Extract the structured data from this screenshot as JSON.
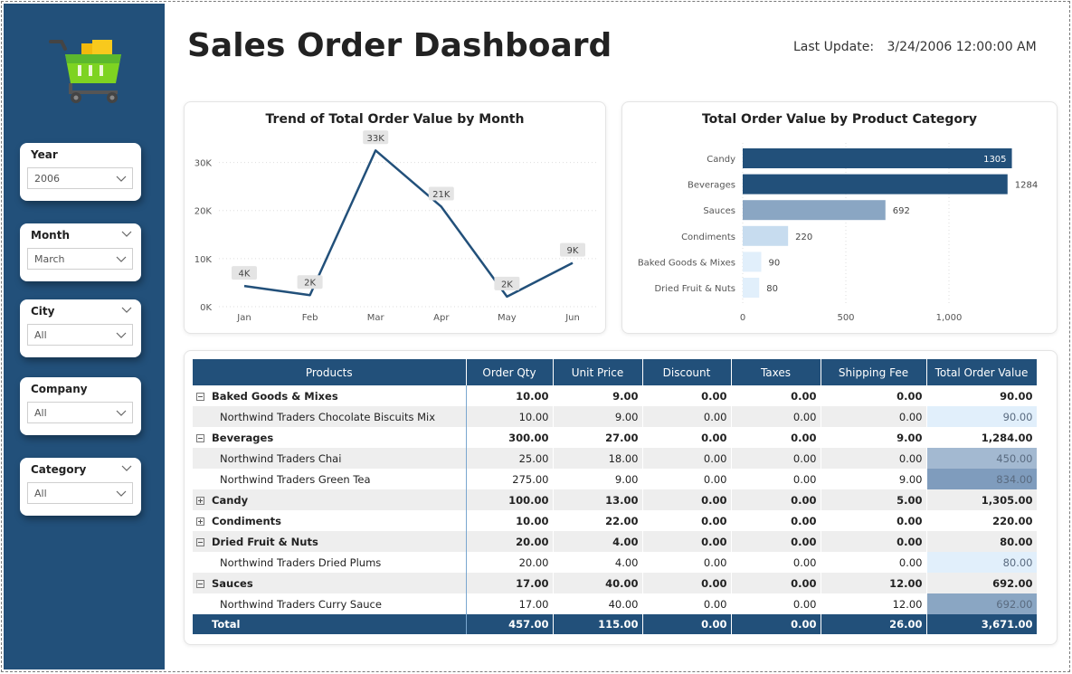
{
  "header": {
    "title": "Sales Order Dashboard",
    "last_update_label": "Last Update:",
    "last_update_value": "3/24/2006 12:00:00 AM"
  },
  "sidebar": {
    "logo_icon": "shopping-cart-icon",
    "slicers": [
      {
        "title": "Year",
        "value": "2006",
        "has_top_chevron": false
      },
      {
        "title": "Month",
        "value": "March",
        "has_top_chevron": true
      },
      {
        "title": "City",
        "value": "All",
        "has_top_chevron": true
      },
      {
        "title": "Company",
        "value": "All",
        "has_top_chevron": false
      },
      {
        "title": "Category",
        "value": "All",
        "has_top_chevron": true
      }
    ]
  },
  "colors": {
    "sidebar": "#22507a",
    "bar_dark": "#22507a",
    "bar_mid": "#8aa6c3",
    "bar_light": "#c7dcef",
    "bar_lightest": "#e1effb",
    "line": "#22507a"
  },
  "chart_data": [
    {
      "type": "line",
      "title": "Trend of Total Order Value by Month",
      "categories": [
        "Jan",
        "Feb",
        "Mar",
        "Apr",
        "May",
        "Jun"
      ],
      "values": [
        4300,
        2400,
        32500,
        20800,
        2100,
        9100
      ],
      "data_labels": [
        "4K",
        "2K",
        "33K",
        "21K",
        "2K",
        "9K"
      ],
      "y_ticks": [
        "0K",
        "10K",
        "20K",
        "30K"
      ],
      "ylim": [
        0,
        35000
      ],
      "grid": true
    },
    {
      "type": "bar",
      "orientation": "horizontal",
      "title": "Total Order Value by Product Category",
      "categories": [
        "Candy",
        "Beverages",
        "Sauces",
        "Condiments",
        "Baked Goods & Mixes",
        "Dried Fruit & Nuts"
      ],
      "values": [
        1305,
        1284,
        692,
        220,
        90,
        80
      ],
      "data_labels": [
        "1305",
        "1284",
        "692",
        "220",
        "90",
        "80"
      ],
      "x_ticks": [
        "0",
        "500",
        "1,000"
      ],
      "xlim": [
        0,
        1500
      ],
      "grid": true
    }
  ],
  "table": {
    "columns": [
      "Products",
      "Order Qty",
      "Unit Price",
      "Discount",
      "Taxes",
      "Shipping Fee",
      "Total Order Value"
    ],
    "rows": [
      {
        "kind": "group",
        "expander": "minus",
        "cells": [
          "Baked Goods & Mixes",
          "10.00",
          "9.00",
          "0.00",
          "0.00",
          "0.00",
          "90.00"
        ],
        "stripe": false,
        "shade": null
      },
      {
        "kind": "detail",
        "cells": [
          "Northwind Traders Chocolate Biscuits Mix",
          "10.00",
          "9.00",
          "0.00",
          "0.00",
          "0.00",
          "90.00"
        ],
        "stripe": true,
        "shade": "#e1effb"
      },
      {
        "kind": "group",
        "expander": "minus",
        "cells": [
          "Beverages",
          "300.00",
          "27.00",
          "0.00",
          "0.00",
          "9.00",
          "1,284.00"
        ],
        "stripe": false,
        "shade": null
      },
      {
        "kind": "detail",
        "cells": [
          "Northwind Traders Chai",
          "25.00",
          "18.00",
          "0.00",
          "0.00",
          "0.00",
          "450.00"
        ],
        "stripe": true,
        "shade": "#a3b9d1"
      },
      {
        "kind": "detail",
        "cells": [
          "Northwind Traders Green Tea",
          "275.00",
          "9.00",
          "0.00",
          "0.00",
          "9.00",
          "834.00"
        ],
        "stripe": false,
        "shade": "#7f9cbd"
      },
      {
        "kind": "group",
        "expander": "plus",
        "cells": [
          "Candy",
          "100.00",
          "13.00",
          "0.00",
          "0.00",
          "5.00",
          "1,305.00"
        ],
        "stripe": true,
        "shade": null
      },
      {
        "kind": "group",
        "expander": "plus",
        "cells": [
          "Condiments",
          "10.00",
          "22.00",
          "0.00",
          "0.00",
          "0.00",
          "220.00"
        ],
        "stripe": false,
        "shade": null
      },
      {
        "kind": "group",
        "expander": "minus",
        "cells": [
          "Dried Fruit & Nuts",
          "20.00",
          "4.00",
          "0.00",
          "0.00",
          "0.00",
          "80.00"
        ],
        "stripe": true,
        "shade": null
      },
      {
        "kind": "detail",
        "cells": [
          "Northwind Traders Dried Plums",
          "20.00",
          "4.00",
          "0.00",
          "0.00",
          "0.00",
          "80.00"
        ],
        "stripe": false,
        "shade": "#e1effb"
      },
      {
        "kind": "group",
        "expander": "minus",
        "cells": [
          "Sauces",
          "17.00",
          "40.00",
          "0.00",
          "0.00",
          "12.00",
          "692.00"
        ],
        "stripe": true,
        "shade": null
      },
      {
        "kind": "detail",
        "cells": [
          "Northwind Traders Curry Sauce",
          "17.00",
          "40.00",
          "0.00",
          "0.00",
          "12.00",
          "692.00"
        ],
        "stripe": false,
        "shade": "#8aa6c3"
      }
    ],
    "total": [
      "Total",
      "457.00",
      "115.00",
      "0.00",
      "0.00",
      "26.00",
      "3,671.00"
    ]
  }
}
